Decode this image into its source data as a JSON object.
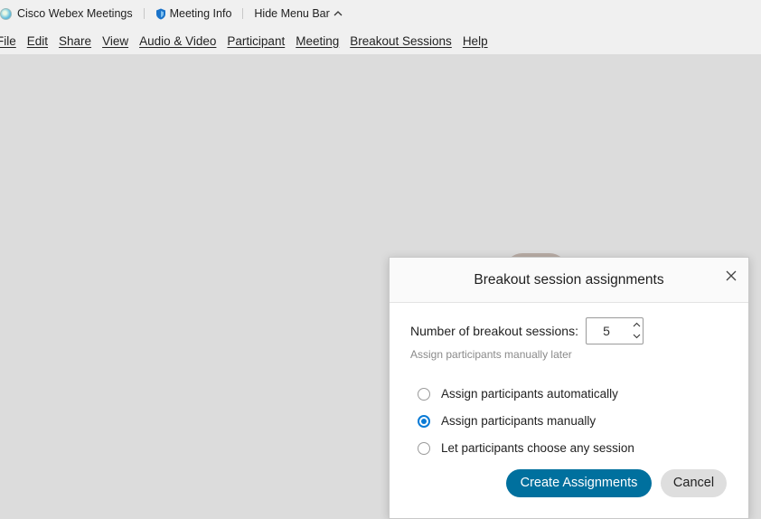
{
  "titlebar": {
    "app_name": "Cisco Webex Meetings",
    "meeting_info": "Meeting Info",
    "hide_menu_bar": "Hide Menu Bar"
  },
  "menu": {
    "items": [
      {
        "label": "File"
      },
      {
        "label": "Edit"
      },
      {
        "label": "Share"
      },
      {
        "label": "View"
      },
      {
        "label": "Audio & Video"
      },
      {
        "label": "Participant"
      },
      {
        "label": "Meeting"
      },
      {
        "label": "Breakout Sessions"
      },
      {
        "label": "Help"
      }
    ]
  },
  "dialog": {
    "title": "Breakout session assignments",
    "num_sessions_label": "Number of breakout sessions:",
    "num_sessions_value": "5",
    "hint": "Assign participants manually later",
    "options": [
      {
        "label": "Assign participants automatically",
        "selected": false
      },
      {
        "label": "Assign participants manually",
        "selected": true
      },
      {
        "label": "Let participants choose any session",
        "selected": false
      }
    ],
    "create_button": "Create Assignments",
    "cancel_button": "Cancel"
  },
  "colors": {
    "primary_button": "#00709e",
    "radio_selected": "#0a7bd6",
    "background": "#dcdcdc"
  }
}
